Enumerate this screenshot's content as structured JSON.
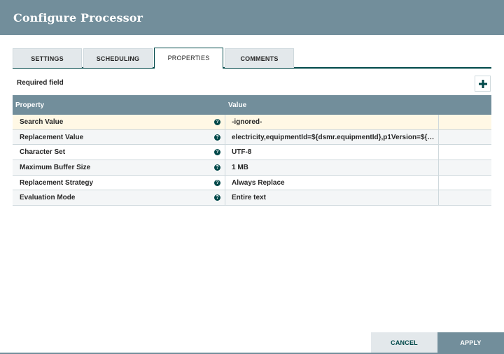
{
  "dialog": {
    "title": "Configure Processor"
  },
  "tabs": [
    {
      "label": "SETTINGS",
      "active": false
    },
    {
      "label": "SCHEDULING",
      "active": false
    },
    {
      "label": "PROPERTIES",
      "active": true
    },
    {
      "label": "COMMENTS",
      "active": false
    }
  ],
  "properties": {
    "required_label": "Required field",
    "add_icon": "plus-icon",
    "help_icon": "question-circle-icon",
    "columns": [
      "Property",
      "Value"
    ],
    "rows": [
      {
        "property": "Search Value",
        "value": "-ignored-"
      },
      {
        "property": "Replacement Value",
        "value": "electricity,equipmentId=${dsmr.equipmentId},p1Version=${…"
      },
      {
        "property": "Character Set",
        "value": "UTF-8"
      },
      {
        "property": "Maximum Buffer Size",
        "value": "1 MB"
      },
      {
        "property": "Replacement Strategy",
        "value": "Always Replace"
      },
      {
        "property": "Evaluation Mode",
        "value": "Entire text"
      }
    ]
  },
  "footer": {
    "cancel_label": "CANCEL",
    "apply_label": "APPLY"
  },
  "colors": {
    "header": "#728e9b",
    "accent": "#004849",
    "selected_row": "#fff8e5"
  }
}
